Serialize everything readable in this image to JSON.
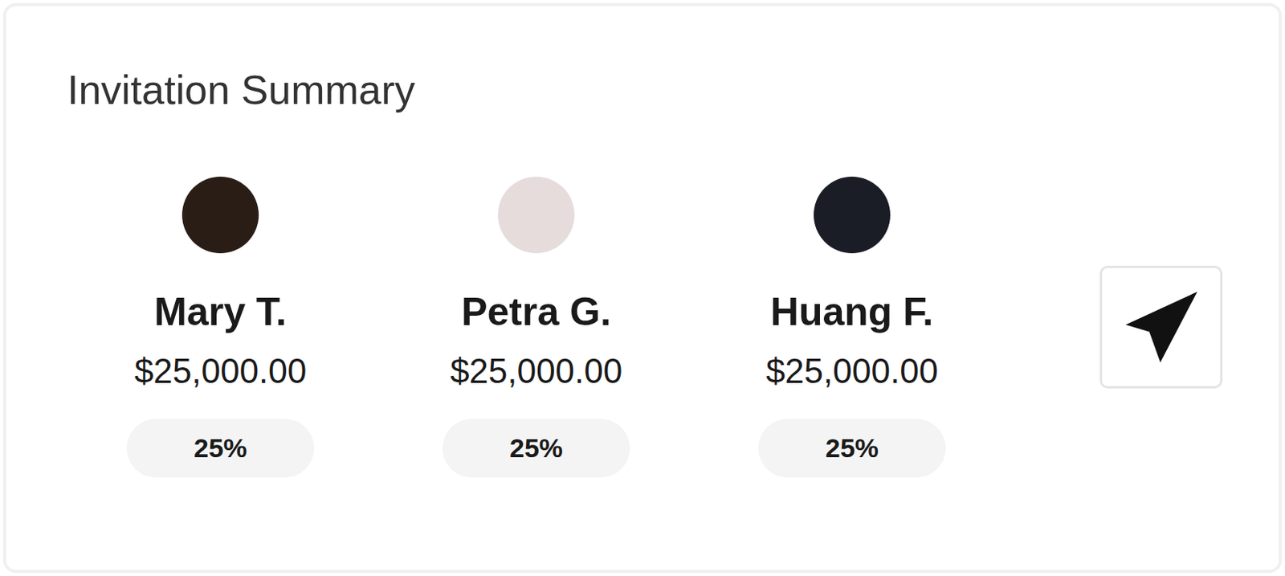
{
  "title": "Invitation Summary",
  "invitees": [
    {
      "name": "Mary T.",
      "amount": "$25,000.00",
      "share": "25%"
    },
    {
      "name": "Petra G.",
      "amount": "$25,000.00",
      "share": "25%"
    },
    {
      "name": "Huang F.",
      "amount": "$25,000.00",
      "share": "25%"
    }
  ]
}
